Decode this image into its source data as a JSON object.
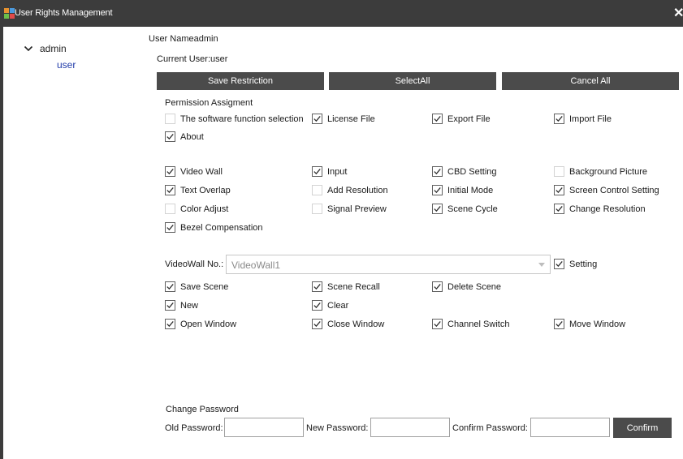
{
  "window": {
    "title": "User Rights Management",
    "close_glyph": "✕",
    "icon": "app-icon"
  },
  "tree": {
    "root": "admin",
    "child": "user"
  },
  "header": {
    "user_name_line": "User Nameadmin",
    "current_user_line": "Current User:user"
  },
  "toolbar": {
    "save_restriction": "Save Restriction",
    "select_all": "SelectAll",
    "cancel_all": "Cancel All"
  },
  "permission": {
    "title": "Permission Assigment",
    "function_items": [
      {
        "label": "The software function selection",
        "checked": false
      },
      {
        "label": "License File",
        "checked": true
      },
      {
        "label": "Export File",
        "checked": true
      },
      {
        "label": "Import File",
        "checked": true
      },
      {
        "label": "About",
        "checked": true
      }
    ],
    "wall_items": [
      {
        "label": "Video Wall",
        "checked": true
      },
      {
        "label": "Input",
        "checked": true
      },
      {
        "label": "CBD Setting",
        "checked": true
      },
      {
        "label": "Background Picture",
        "checked": false
      },
      {
        "label": "Text Overlap",
        "checked": true
      },
      {
        "label": "Add Resolution",
        "checked": false
      },
      {
        "label": "Initial Mode",
        "checked": true
      },
      {
        "label": "Screen Control Setting",
        "checked": true
      },
      {
        "label": "Color Adjust",
        "checked": false
      },
      {
        "label": "Signal Preview",
        "checked": false
      },
      {
        "label": "Scene Cycle",
        "checked": true
      },
      {
        "label": "Change Resolution",
        "checked": true
      },
      {
        "label": "Bezel Compensation",
        "checked": true
      }
    ]
  },
  "videowall": {
    "label": "VideoWall No.:",
    "selected": "VideoWall1",
    "setting": {
      "label": "Setting",
      "checked": true
    },
    "scene_items": [
      {
        "label": "Save Scene",
        "checked": true
      },
      {
        "label": "Scene Recall",
        "checked": true
      },
      {
        "label": "Delete Scene",
        "checked": true
      },
      {
        "label": "New",
        "checked": true
      },
      {
        "label": "Clear",
        "checked": true
      },
      {
        "label": "Open Window",
        "checked": true
      },
      {
        "label": "Close Window",
        "checked": true
      },
      {
        "label": "Channel Switch",
        "checked": true
      },
      {
        "label": "Move Window",
        "checked": true
      }
    ]
  },
  "password": {
    "title": "Change Password",
    "old_label": "Old Password:",
    "new_label": "New Password:",
    "confirm_label": "Confirm Password:",
    "old_value": "",
    "new_value": "",
    "confirm_value": "",
    "confirm_button": "Confirm"
  },
  "colors": {
    "title_bar": "#3c3c3c",
    "button": "#4b4b4b",
    "tree_link": "#1f3aa8"
  }
}
